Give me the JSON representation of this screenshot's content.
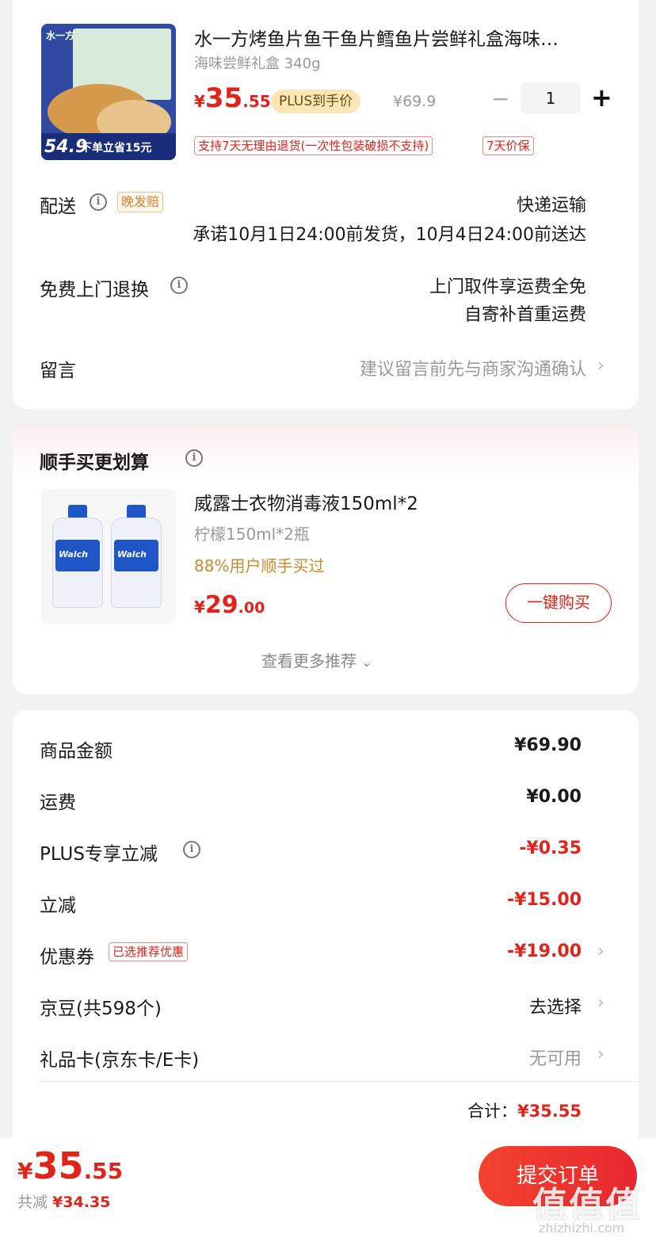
{
  "product": {
    "thumb_brand": "水一方",
    "thumb_banner": "下单立省15元",
    "thumb_price": "54.9",
    "title": "水一方烤鱼片鱼干鱼片鳕鱼片尝鲜礼盒海味…",
    "spec": "海味尝鲜礼盒 340g",
    "price_symbol": "¥",
    "price_int": "35",
    "price_dec": ".55",
    "plus_label": "PLUS到手价",
    "original_price": "¥69.9",
    "qty_minus": "−",
    "qty": "1",
    "qty_plus": "+",
    "tag_return": "支持7天无理由退货(一次性包装破损不支持)",
    "tag_price": "7天价保"
  },
  "delivery": {
    "label": "配送",
    "late_tag": "晚发赔",
    "method": "快递运输",
    "promise": "承诺10月1日24:00前发货，10月4日24:00前送达"
  },
  "return_service": {
    "label": "免费上门退换",
    "line1": "上门取件享运费全免",
    "line2": "自寄补首重运费"
  },
  "message": {
    "label": "留言",
    "placeholder": "建议留言前先与商家沟通确认"
  },
  "addon": {
    "heading": "顺手买更划算",
    "title": "威露士衣物消毒液150ml*2",
    "spec": "柠檬150ml*2瓶",
    "stat": "88%用户顺手买过",
    "price_symbol": "¥",
    "price_int": "29",
    "price_dec": ".00",
    "buy_label": "一键购买",
    "more_label": "查看更多推荐",
    "bottle_brand": "Walch"
  },
  "summary": {
    "rows": [
      {
        "label": "商品金额",
        "value": "¥69.90"
      },
      {
        "label": "运费",
        "value": "¥0.00"
      },
      {
        "label": "PLUS专享立减",
        "value": "-¥0.35"
      },
      {
        "label": "立减",
        "value": "-¥15.00"
      },
      {
        "label": "优惠券",
        "tag": "已选推荐优惠",
        "value": "-¥19.00"
      },
      {
        "label": "京豆(共598个)",
        "value": "去选择"
      },
      {
        "label": "礼品卡(京东卡/E卡)",
        "value": "无可用"
      }
    ],
    "total_label": "合计：",
    "total_value": "¥35.55"
  },
  "footer": {
    "price_symbol": "¥",
    "price_int": "35",
    "price_dec": ".55",
    "saved_label": "共减",
    "saved_value": "¥34.35",
    "submit_label": "提交订单",
    "watermark": "值值值",
    "watermark_url": "zhizhizhi.com"
  },
  "colors": {
    "accent_red": "#e2231a",
    "plus_gold": "#fbe7b5",
    "addon_orange": "#c98a2e"
  }
}
